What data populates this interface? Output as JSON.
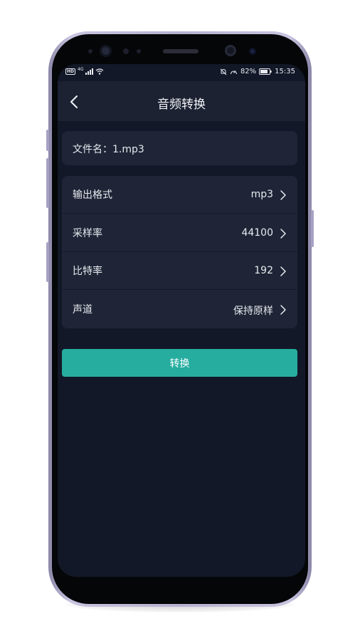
{
  "status_bar": {
    "network_badge": "HD",
    "signal_type": "4G",
    "battery_percent": "82%",
    "time": "15:35"
  },
  "header": {
    "title": "音频转换"
  },
  "file": {
    "label": "文件名：1.mp3"
  },
  "settings": [
    {
      "label": "输出格式",
      "value": "mp3"
    },
    {
      "label": "采样率",
      "value": "44100"
    },
    {
      "label": "比特率",
      "value": "192"
    },
    {
      "label": "声道",
      "value": "保持原样"
    }
  ],
  "actions": {
    "convert_label": "转换"
  },
  "colors": {
    "background": "#131828",
    "card": "#1f2536",
    "nav_bar": "#1c2232",
    "accent": "#26ada0",
    "text": "#e8eaf0",
    "phone_frame": "#b6b1d0"
  },
  "icons": {
    "back": "chevron-left-icon",
    "row_arrow": "chevron-right-icon",
    "wifi": "wifi-icon",
    "mute": "bell-muted-icon",
    "speed": "gauge-icon",
    "battery": "battery-icon"
  }
}
